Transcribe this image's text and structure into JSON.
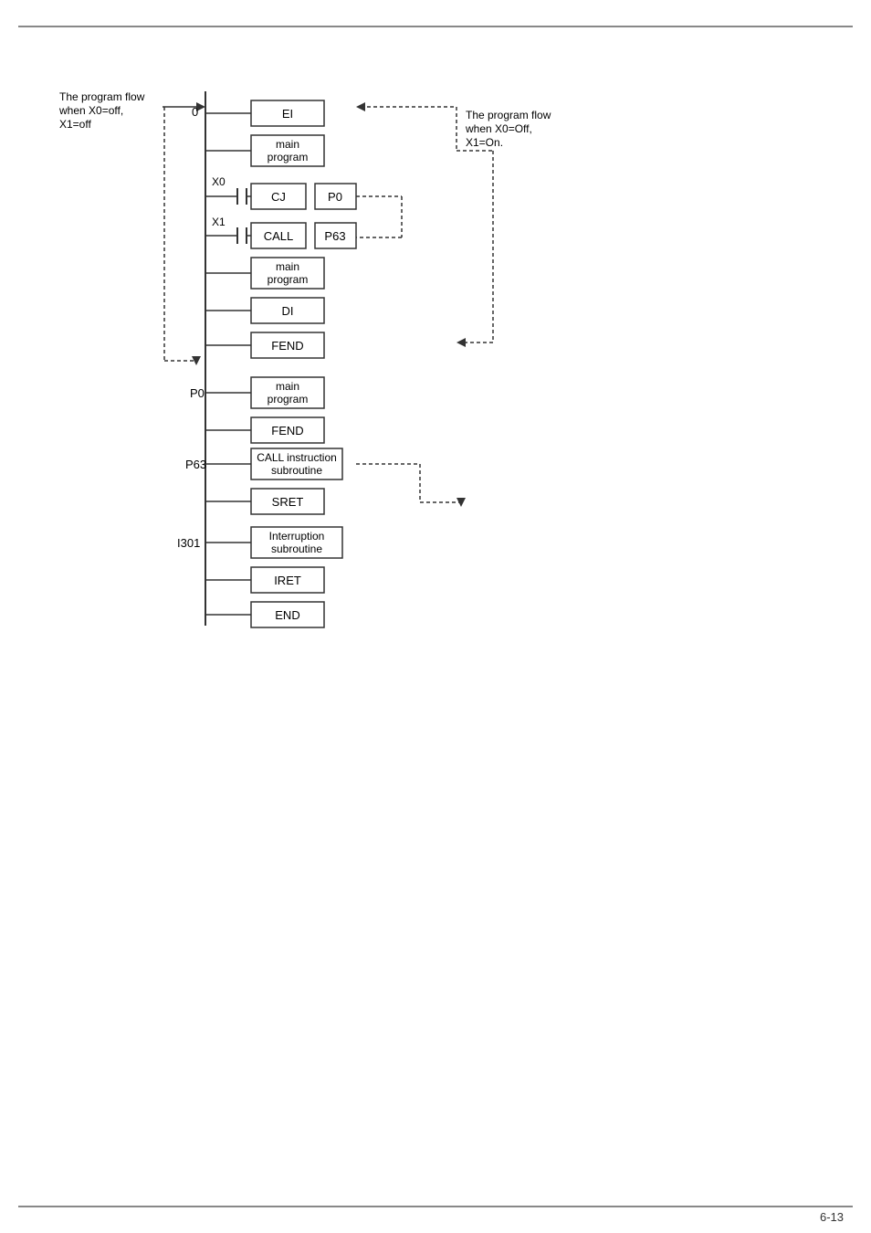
{
  "page": {
    "number": "6-13",
    "top_border": true,
    "bottom_border": true
  },
  "left_annotation": {
    "line1": "The program flow",
    "line2": "when X0=off,",
    "line3": "X1=off"
  },
  "right_annotation": {
    "line1": "The program flow",
    "line2": "when X0=Off,",
    "line3": "X1=On."
  },
  "instructions": [
    {
      "id": "EI",
      "label": "EI",
      "row_label": "0"
    },
    {
      "id": "main1",
      "label": "main\nprogram",
      "row_label": ""
    },
    {
      "id": "CJ",
      "label": "CJ",
      "param": "P0",
      "row_label": "X0"
    },
    {
      "id": "CALL",
      "label": "CALL",
      "param": "P63",
      "row_label": "X1"
    },
    {
      "id": "main2",
      "label": "main\nprogram",
      "row_label": ""
    },
    {
      "id": "DI",
      "label": "DI",
      "row_label": ""
    },
    {
      "id": "FEND1",
      "label": "FEND",
      "row_label": ""
    },
    {
      "id": "main3",
      "label": "main\nprogram",
      "row_label": "P0"
    },
    {
      "id": "FEND2",
      "label": "FEND",
      "row_label": ""
    },
    {
      "id": "call_sub",
      "label": "CALL instruction\nsubroutine",
      "row_label": "P63"
    },
    {
      "id": "SRET",
      "label": "SRET",
      "row_label": ""
    },
    {
      "id": "int_sub",
      "label": "Interruption\nsubroutine",
      "row_label": "I301"
    },
    {
      "id": "IRET",
      "label": "IRET",
      "row_label": ""
    },
    {
      "id": "END",
      "label": "END",
      "row_label": ""
    }
  ]
}
